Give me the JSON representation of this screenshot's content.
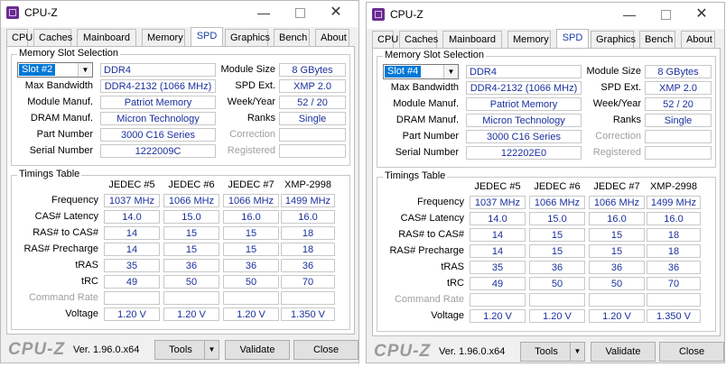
{
  "windows": [
    {
      "title": "CPU-Z",
      "tabs": [
        "CPU",
        "Caches",
        "Mainboard",
        "Memory",
        "SPD",
        "Graphics",
        "Bench",
        "About"
      ],
      "active_tab": "SPD",
      "slot_group_title": "Memory Slot Selection",
      "slot_selected": "Slot #2",
      "memory_type": "DDR4",
      "labels": {
        "max_bandwidth": "Max Bandwidth",
        "module_manuf": "Module Manuf.",
        "dram_manuf": "DRAM Manuf.",
        "part_number": "Part Number",
        "serial_number": "Serial Number",
        "module_size": "Module Size",
        "spd_ext": "SPD Ext.",
        "week_year": "Week/Year",
        "ranks": "Ranks",
        "correction": "Correction",
        "registered": "Registered"
      },
      "values": {
        "max_bandwidth": "DDR4-2132 (1066 MHz)",
        "module_manuf": "Patriot Memory",
        "dram_manuf": "Micron Technology",
        "part_number": "3000 C16 Series",
        "serial_number": "1222009C",
        "module_size": "8 GBytes",
        "spd_ext": "XMP 2.0",
        "week_year": "52 / 20",
        "ranks": "Single",
        "correction": "",
        "registered": ""
      },
      "timings_title": "Timings Table",
      "timing_columns": [
        "JEDEC #5",
        "JEDEC #6",
        "JEDEC #7",
        "XMP-2998"
      ],
      "timing_rows": [
        {
          "label": "Frequency",
          "dim": false,
          "values": [
            "1037 MHz",
            "1066 MHz",
            "1066 MHz",
            "1499 MHz"
          ]
        },
        {
          "label": "CAS# Latency",
          "dim": false,
          "values": [
            "14.0",
            "15.0",
            "16.0",
            "16.0"
          ]
        },
        {
          "label": "RAS# to CAS#",
          "dim": false,
          "values": [
            "14",
            "15",
            "15",
            "18"
          ]
        },
        {
          "label": "RAS# Precharge",
          "dim": false,
          "values": [
            "14",
            "15",
            "15",
            "18"
          ]
        },
        {
          "label": "tRAS",
          "dim": false,
          "values": [
            "35",
            "36",
            "36",
            "36"
          ]
        },
        {
          "label": "tRC",
          "dim": false,
          "values": [
            "49",
            "50",
            "50",
            "70"
          ]
        },
        {
          "label": "Command Rate",
          "dim": true,
          "values": [
            "",
            "",
            "",
            ""
          ]
        },
        {
          "label": "Voltage",
          "dim": false,
          "values": [
            "1.20 V",
            "1.20 V",
            "1.20 V",
            "1.350 V"
          ]
        }
      ],
      "brand": "CPU-Z",
      "version": "Ver. 1.96.0.x64",
      "tools_label": "Tools",
      "validate_label": "Validate",
      "close_label": "Close"
    },
    {
      "title": "CPU-Z",
      "tabs": [
        "CPU",
        "Caches",
        "Mainboard",
        "Memory",
        "SPD",
        "Graphics",
        "Bench",
        "About"
      ],
      "active_tab": "SPD",
      "slot_group_title": "Memory Slot Selection",
      "slot_selected": "Slot #4",
      "memory_type": "DDR4",
      "labels": {
        "max_bandwidth": "Max Bandwidth",
        "module_manuf": "Module Manuf.",
        "dram_manuf": "DRAM Manuf.",
        "part_number": "Part Number",
        "serial_number": "Serial Number",
        "module_size": "Module Size",
        "spd_ext": "SPD Ext.",
        "week_year": "Week/Year",
        "ranks": "Ranks",
        "correction": "Correction",
        "registered": "Registered"
      },
      "values": {
        "max_bandwidth": "DDR4-2132 (1066 MHz)",
        "module_manuf": "Patriot Memory",
        "dram_manuf": "Micron Technology",
        "part_number": "3000 C16 Series",
        "serial_number": "122202E0",
        "module_size": "8 GBytes",
        "spd_ext": "XMP 2.0",
        "week_year": "52 / 20",
        "ranks": "Single",
        "correction": "",
        "registered": ""
      },
      "timings_title": "Timings Table",
      "timing_columns": [
        "JEDEC #5",
        "JEDEC #6",
        "JEDEC #7",
        "XMP-2998"
      ],
      "timing_rows": [
        {
          "label": "Frequency",
          "dim": false,
          "values": [
            "1037 MHz",
            "1066 MHz",
            "1066 MHz",
            "1499 MHz"
          ]
        },
        {
          "label": "CAS# Latency",
          "dim": false,
          "values": [
            "14.0",
            "15.0",
            "16.0",
            "16.0"
          ]
        },
        {
          "label": "RAS# to CAS#",
          "dim": false,
          "values": [
            "14",
            "15",
            "15",
            "18"
          ]
        },
        {
          "label": "RAS# Precharge",
          "dim": false,
          "values": [
            "14",
            "15",
            "15",
            "18"
          ]
        },
        {
          "label": "tRAS",
          "dim": false,
          "values": [
            "35",
            "36",
            "36",
            "36"
          ]
        },
        {
          "label": "tRC",
          "dim": false,
          "values": [
            "49",
            "50",
            "50",
            "70"
          ]
        },
        {
          "label": "Command Rate",
          "dim": true,
          "values": [
            "",
            "",
            "",
            ""
          ]
        },
        {
          "label": "Voltage",
          "dim": false,
          "values": [
            "1.20 V",
            "1.20 V",
            "1.20 V",
            "1.350 V"
          ]
        }
      ],
      "brand": "CPU-Z",
      "version": "Ver. 1.96.0.x64",
      "tools_label": "Tools",
      "validate_label": "Validate",
      "close_label": "Close"
    }
  ]
}
